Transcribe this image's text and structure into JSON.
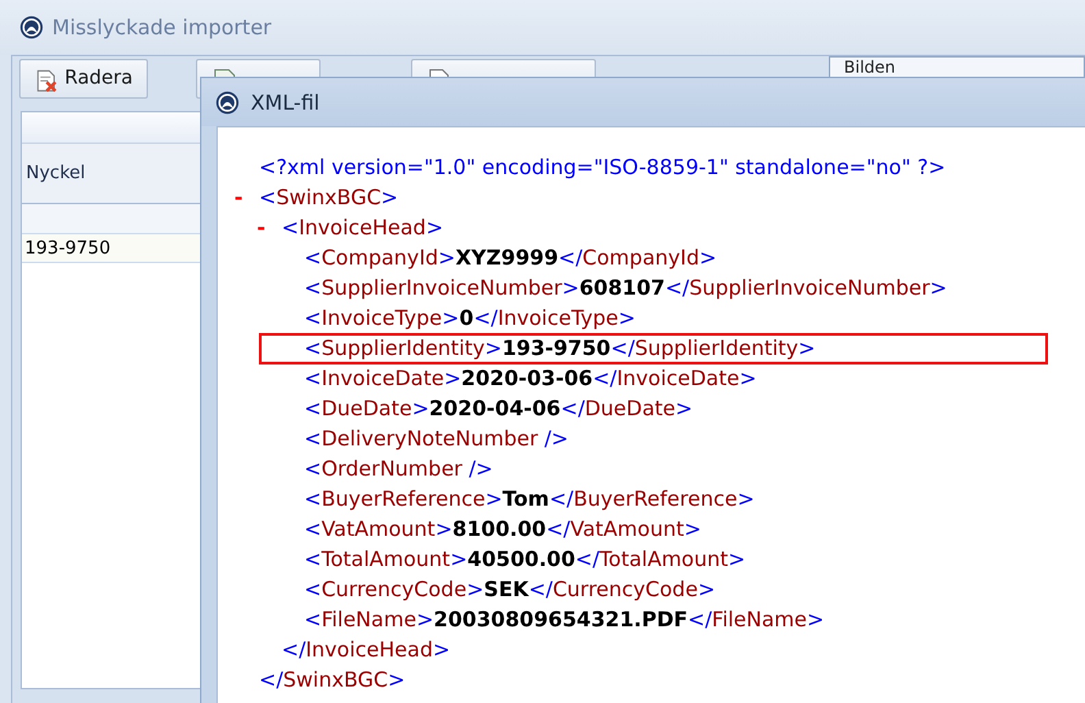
{
  "window": {
    "title": "Misslyckade importer"
  },
  "toolbar": [
    {
      "label": "Radera",
      "kind": "delete"
    },
    {
      "kind": "xml"
    },
    {
      "kind": "new"
    }
  ],
  "image_panel": {
    "title": "Bilden"
  },
  "grid": {
    "columns": [
      "Nyckel"
    ],
    "rows": [
      [
        "193-9750"
      ]
    ]
  },
  "xml_window": {
    "title": "XML-fil",
    "declaration": "<?xml version=\"1.0\" encoding=\"ISO-8859-1\" standalone=\"no\" ?>",
    "root": {
      "toggle": "-",
      "open": [
        "<",
        "SwinxBGC",
        ">"
      ],
      "close": [
        "</",
        "SwinxBGC",
        ">"
      ],
      "children": [
        {
          "toggle": "-",
          "open": [
            "<",
            "InvoiceHead",
            ">"
          ],
          "close": [
            "</",
            "InvoiceHead",
            ">"
          ],
          "children": [
            {
              "open": [
                "<",
                "CompanyId",
                ">"
              ],
              "value": "XYZ9999",
              "close": [
                "</",
                "CompanyId",
                ">"
              ],
              "highlighted": false
            },
            {
              "open": [
                "<",
                "SupplierInvoiceNumber",
                ">"
              ],
              "value": "608107",
              "close": [
                "</",
                "SupplierInvoiceNumber",
                ">"
              ],
              "highlighted": false
            },
            {
              "open": [
                "<",
                "InvoiceType",
                ">"
              ],
              "value": "0",
              "close": [
                "</",
                "InvoiceType",
                ">"
              ],
              "highlighted": false
            },
            {
              "open": [
                "<",
                "SupplierIdentity",
                ">"
              ],
              "value": "193-9750",
              "close": [
                "</",
                "SupplierIdentity",
                ">"
              ],
              "highlighted": true
            },
            {
              "open": [
                "<",
                "InvoiceDate",
                ">"
              ],
              "value": "2020-03-06",
              "close": [
                "</",
                "InvoiceDate",
                ">"
              ],
              "highlighted": false
            },
            {
              "open": [
                "<",
                "DueDate",
                ">"
              ],
              "value": "2020-04-06",
              "close": [
                "</",
                "DueDate",
                ">"
              ],
              "highlighted": false
            },
            {
              "open": [
                "<",
                "DeliveryNoteNumber",
                " />"
              ],
              "highlighted": false
            },
            {
              "open": [
                "<",
                "OrderNumber",
                " />"
              ],
              "highlighted": false
            },
            {
              "open": [
                "<",
                "BuyerReference",
                ">"
              ],
              "value": "Tom",
              "close": [
                "</",
                "BuyerReference",
                ">"
              ],
              "highlighted": false
            },
            {
              "open": [
                "<",
                "VatAmount",
                ">"
              ],
              "value": "8100.00",
              "close": [
                "</",
                "VatAmount",
                ">"
              ],
              "highlighted": false
            },
            {
              "open": [
                "<",
                "TotalAmount",
                ">"
              ],
              "value": "40500.00",
              "close": [
                "</",
                "TotalAmount",
                ">"
              ],
              "highlighted": false
            },
            {
              "open": [
                "<",
                "CurrencyCode",
                ">"
              ],
              "value": "SEK",
              "close": [
                "</",
                "CurrencyCode",
                ">"
              ],
              "highlighted": false
            },
            {
              "open": [
                "<",
                "FileName",
                ">"
              ],
              "value": "20030809654321.PDF",
              "close": [
                "</",
                "FileName",
                ">"
              ],
              "highlighted": false
            }
          ]
        }
      ]
    }
  }
}
